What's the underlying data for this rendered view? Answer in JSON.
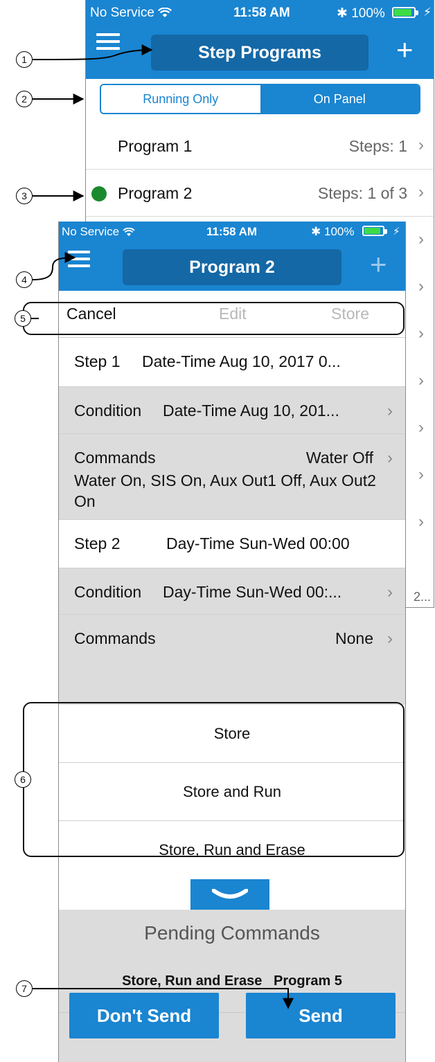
{
  "colors": {
    "accent": "#1a85d1",
    "accent_dark": "#1468a6",
    "status_green": "#1a8a2e",
    "battery_green": "#3ddc46"
  },
  "status_bar": {
    "carrier": "No Service",
    "time": "11:58 AM",
    "battery": "100%"
  },
  "back_screen": {
    "title": "Step Programs",
    "segments": [
      "Running Only",
      "On Panel"
    ],
    "active_segment": "On Panel",
    "programs": [
      {
        "name": "Program 1",
        "steps": "Steps: 1",
        "running": false
      },
      {
        "name": "Program 2",
        "steps": "Steps: 1 of 3",
        "running": true
      }
    ],
    "peek_text": "2..."
  },
  "front_screen": {
    "title": "Program 2",
    "edit_bar": {
      "cancel": "Cancel",
      "edit": "Edit",
      "store": "Store"
    },
    "rows": {
      "step1": {
        "label": "Step 1",
        "value": "Date-Time Aug 10, 2017 0..."
      },
      "cond1": {
        "label": "Condition",
        "value": "Date-Time Aug 10, 201..."
      },
      "cmd1": {
        "label": "Commands",
        "value": "Water Off",
        "detail": "Water On, SIS On, Aux Out1 Off, Aux Out2 On"
      },
      "step2": {
        "label": "Step 2",
        "value": "Day-Time Sun-Wed 00:00"
      },
      "cond2": {
        "label": "Condition",
        "value": "Day-Time Sun-Wed 00:..."
      },
      "cmd2": {
        "label": "Commands",
        "value": "None"
      }
    },
    "store_options": [
      "Store",
      "Store and Run",
      "Store, Run and Erase"
    ],
    "pending": {
      "title": "Pending Commands",
      "item": "Store, Run and Erase   Program 5"
    },
    "buttons": {
      "dont_send": "Don't Send",
      "send": "Send"
    }
  },
  "callouts": [
    "1",
    "2",
    "3",
    "4",
    "5",
    "6",
    "7"
  ],
  "icons": {
    "menu": "hamburger-icon",
    "add": "plus-icon",
    "disclosure": "chevron-right-icon",
    "collapse": "chevron-down-icon",
    "wifi": "wifi-icon",
    "bluetooth": "bluetooth-icon",
    "battery": "battery-icon"
  }
}
